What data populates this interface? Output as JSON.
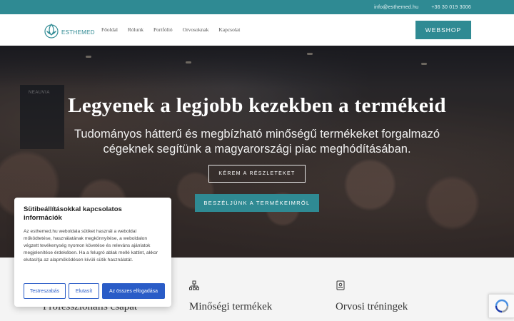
{
  "topbar": {
    "email": "info@esthemed.hu",
    "phone": "+36 30 019 3006"
  },
  "header": {
    "logo_text": "ESTHEMED",
    "nav": [
      {
        "label": "Főoldal"
      },
      {
        "label": "Rólunk"
      },
      {
        "label": "Portfólió"
      },
      {
        "label": "Orvosoknak"
      },
      {
        "label": "Kapcsolat"
      }
    ],
    "webshop_label": "WEBSHOP"
  },
  "hero": {
    "banner_text": "NEAUVIA",
    "title": "Legyenek a legjobb kezekben a termékeid",
    "subtitle": "Tudományos hátterű és megbízható minőségű termékeket forgalmazó cégeknek segítünk a magyarországi piac meghódításában.",
    "btn_outline": "KÉREM A RÉSZLETEKET",
    "btn_solid": "BESZÉLJÜNK A TERMÉKEIMRŐL"
  },
  "features": [
    {
      "title": "Professzionális csapat",
      "icon": "team-icon"
    },
    {
      "title": "Minőségi termékek",
      "icon": "quality-icon"
    },
    {
      "title": "Orvosi tréningek",
      "icon": "training-icon"
    }
  ],
  "cookie": {
    "title": "Sütibeállításokkal kapcsolatos információk",
    "text": "Az esthemed.hu weboldala sütiket használ a weboldal működtetése, használatának megkönnyítése, a weboldalon végzett tevékenység nyomon követése és releváns ajánlatok megjelenítése érdekében. Ha a felugró ablak mellé kattint, akkor elutasítja az alapműködésen kívüli sütik használatát.",
    "btn_settings": "Testreszabás",
    "btn_reject": "Elutasít",
    "btn_accept": "Az összes elfogadása"
  },
  "colors": {
    "brand": "#2f8a93",
    "cookie_accent": "#2a5cc7"
  }
}
